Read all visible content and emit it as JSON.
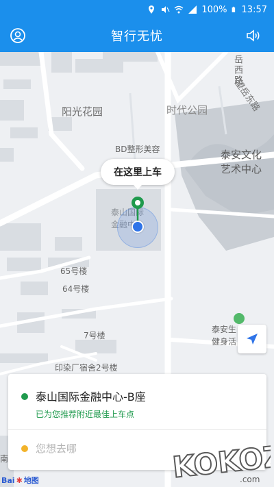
{
  "status_bar": {
    "battery_percent": "100%",
    "time": "13:57"
  },
  "app_bar": {
    "title": "智行无忧",
    "left_icon": "profile-icon",
    "right_icon": "speaker-icon"
  },
  "map": {
    "labels": {
      "yangguang": "阳光花园",
      "shidai_park": "时代公园",
      "bd_beauty": "BD整形美容",
      "taian_culture": "泰安文化",
      "art_center": "艺术中心",
      "taishan_building_line1": "泰山国际",
      "taishan_building_line2": "金融中",
      "building_65": "65号楼",
      "building_64": "64号楼",
      "building_7": "7号楼",
      "yinran_dorm": "印染厂宿舍2号楼",
      "taian_health_line1": "泰安生",
      "taian_health_line2": "健身活",
      "road_yuexi": "岳西路",
      "road_wangyuedong": "望岳东路",
      "nan": "南"
    },
    "pickup_bubble": "在这里上车",
    "locate_icon": "navigation-arrow-icon"
  },
  "trip_card": {
    "start_title": "泰山国际金融中心-B座",
    "start_subtitle": "已为您推荐附近最佳上车点",
    "destination_placeholder": "您想去哪"
  },
  "footer": {
    "baidu_text": "Bai",
    "baidu_map": "地图"
  },
  "watermark_text": "KOKOZ.com",
  "colors": {
    "primary": "#1b8fec",
    "start_dot": "#1f9a4d",
    "end_dot": "#f2b32a",
    "location_dot": "#2f74e8"
  }
}
